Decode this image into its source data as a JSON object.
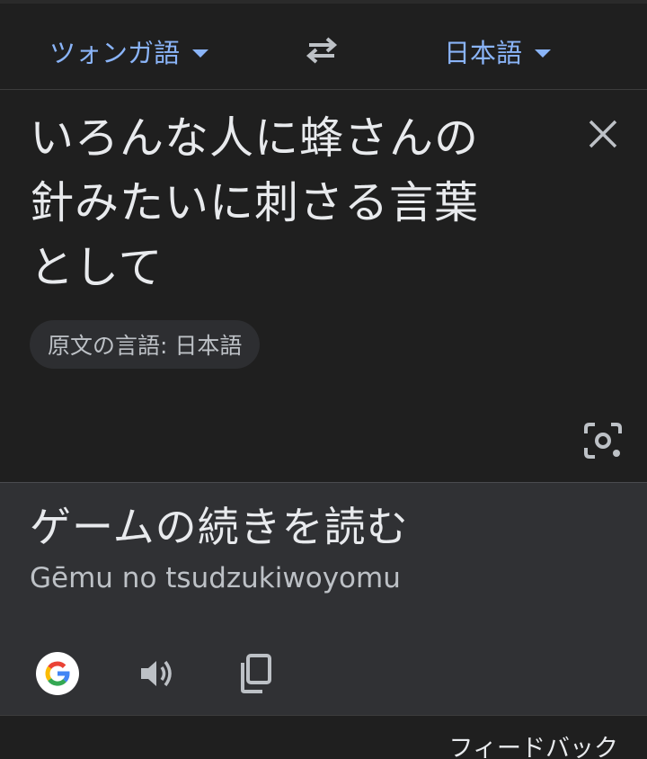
{
  "language_bar": {
    "source_language": "ツォンガ語",
    "target_language": "日本語"
  },
  "source": {
    "text_lines": [
      "いろんな人に蜂さんの",
      "針みたいに刺さる言葉",
      "として"
    ],
    "detected_language_chip": "原文の言語: 日本語"
  },
  "result": {
    "translation": "ゲームの続きを読む",
    "romanization": "Gēmu no tsudzukiwoyomu"
  },
  "footer": {
    "feedback_label": "フィードバック"
  },
  "icons": [
    "swap-icon",
    "close-icon",
    "camera-lens-icon",
    "google-g-icon",
    "speaker-icon",
    "copy-icon"
  ],
  "colors": {
    "background": "#1f1f1f",
    "result_background": "#303134",
    "accent": "#8ab4f8",
    "text_primary": "#e8eaed",
    "text_secondary": "#bdc1c6"
  }
}
